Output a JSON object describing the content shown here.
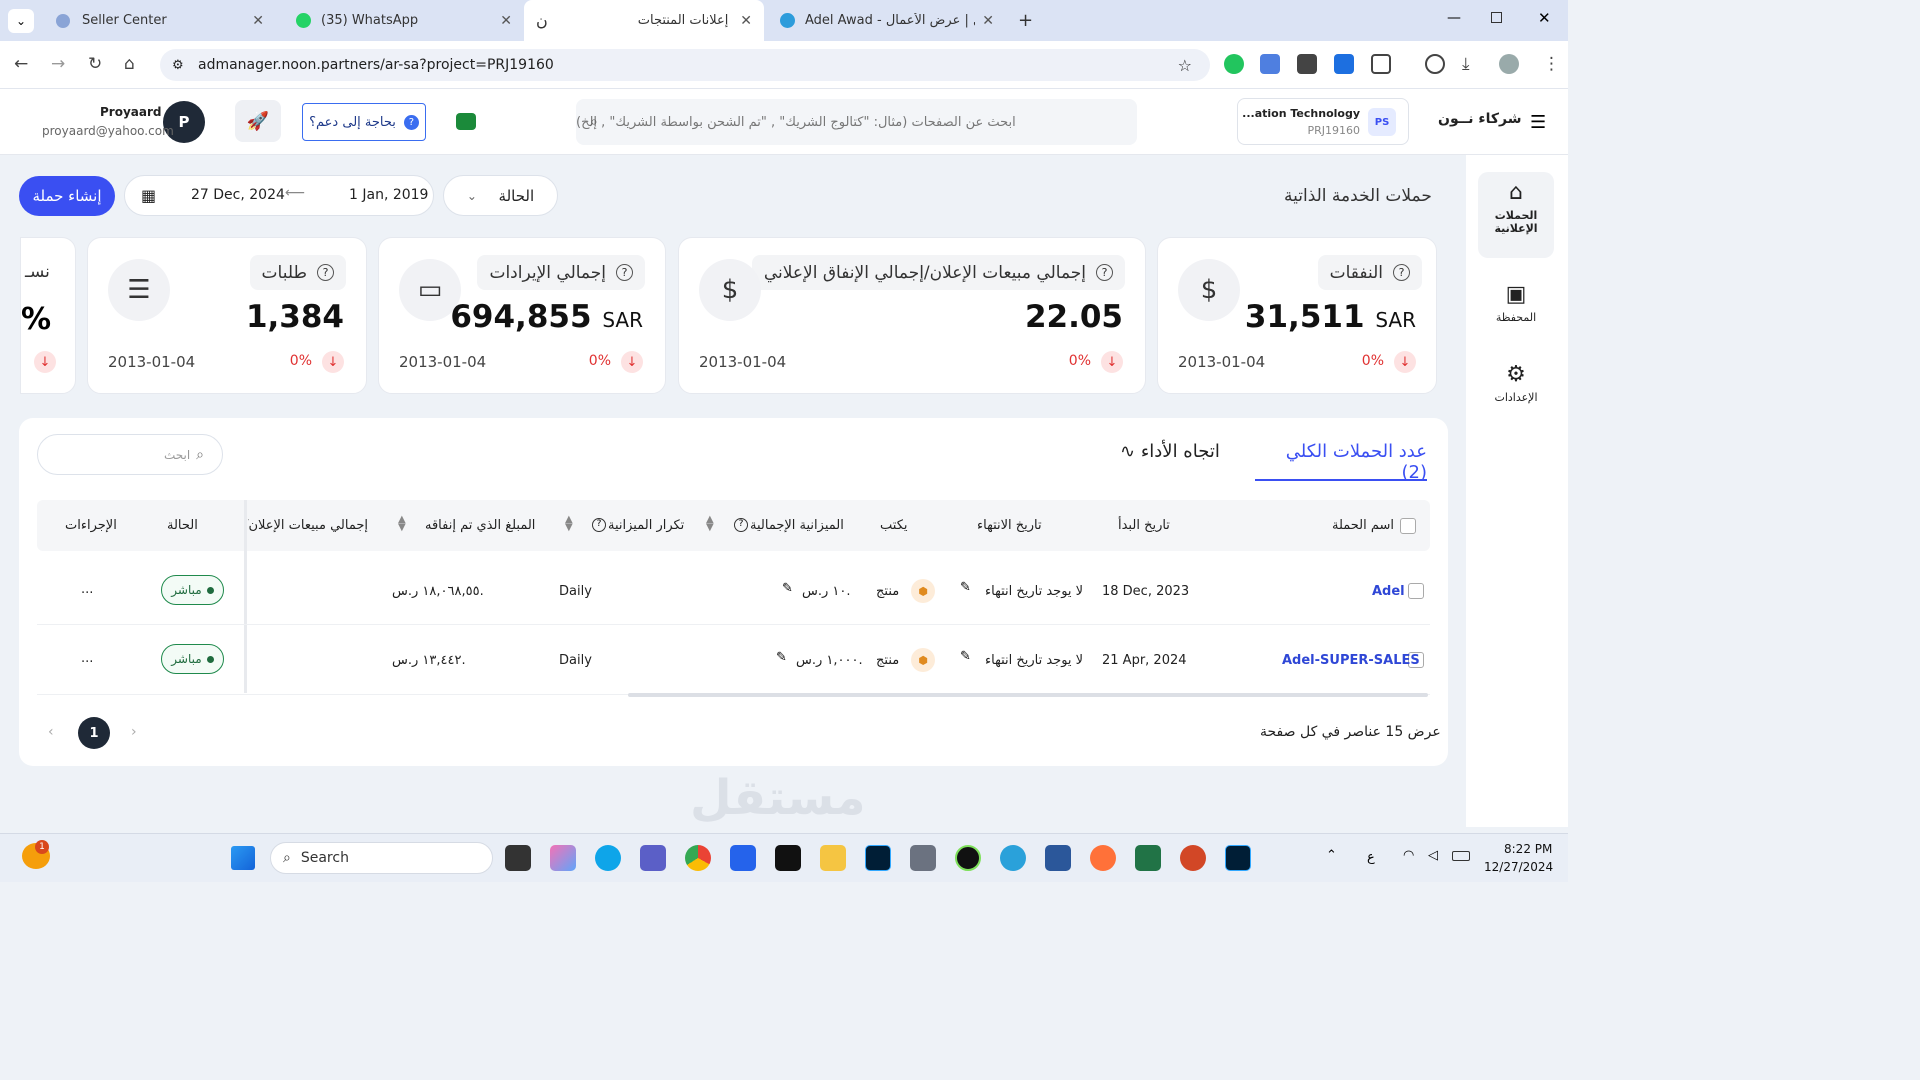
{
  "browser": {
    "tabs": [
      {
        "title": "Seller Center",
        "active": false
      },
      {
        "title": "(35) WhatsApp",
        "active": false
      },
      {
        "title": "إعلانات المنتجات",
        "active": true
      },
      {
        "title": "Adel Awad - مستقل | عرض الأعمال",
        "active": false
      }
    ],
    "url": "admanager.noon.partners/ar-sa?project=PRJ19160"
  },
  "header": {
    "brand": "شركاء نــون",
    "project_name": "...ation Technology",
    "project_id": "PRJ19160",
    "project_badge": "PS",
    "search_placeholder": "ابحث عن الصفحات (مثال: \"كتالوج الشريك\" , \"تم الشحن بواسطة الشريك\" , إلخ)",
    "help_label": "بحاجة إلى دعم؟",
    "user_name": "Proyaard",
    "user_email": "proyaard@yahoo.com",
    "avatar_letter": "P"
  },
  "sidenav": [
    {
      "label": "الحملات الإعلانية",
      "icon": "home-icon",
      "active": true
    },
    {
      "label": "المحفظة",
      "icon": "wallet-icon",
      "active": false
    },
    {
      "label": "الإعدادات",
      "icon": "settings-icon",
      "active": false
    }
  ],
  "toolbar": {
    "title": "حملات الخدمة الذاتية",
    "status_filter": "الحالة",
    "date_from": "1 Jan, 2019",
    "date_to": "27 Dec, 2024",
    "create_label": "إنشاء حملة"
  },
  "kpis": [
    {
      "label": "النفقات",
      "value": "31,511",
      "unit": "SAR",
      "date": "2013-01-04",
      "change": "0%",
      "icon": "dollar-coin-icon"
    },
    {
      "label": "إجمالي مبيعات الإعلان/إجمالي الإنفاق الإعلاني",
      "value": "22.05",
      "unit": "",
      "date": "2013-01-04",
      "change": "0%",
      "icon": "dollar-return-icon"
    },
    {
      "label": "إجمالي الإيرادات",
      "value": "694,855",
      "unit": "SAR",
      "date": "2013-01-04",
      "change": "0%",
      "icon": "banknote-icon"
    },
    {
      "label": "طلبات",
      "value": "1,384",
      "unit": "",
      "date": "2013-01-04",
      "change": "0%",
      "icon": "orders-list-icon"
    },
    {
      "label": "نسـ",
      "value": "%",
      "unit": "",
      "date": "",
      "change": "",
      "icon": ""
    }
  ],
  "panel": {
    "tab_count": "عدد الحملات الكلي (2)",
    "tab_trend": "اتجاه الأداء",
    "search_placeholder": "ابحث",
    "columns": [
      "اسم الحملة",
      "تاريخ البدأ",
      "تاريخ الانتهاء",
      "يكتب",
      "الميزانية الإجمالية",
      "تكرار الميزانية",
      "المبلغ الذي تم إنفاقه",
      "إجمالي مبيعات الإعلان/إ",
      "الحالة",
      "الإجراءات"
    ],
    "rows": [
      {
        "name": "Adel",
        "start": "18 Dec, 2023",
        "end": "لا يوجد تاريخ انتهاء",
        "type": "منتج",
        "budget": "١٠ ر.س.",
        "frequency": "Daily",
        "spent": "١٨,٠٦٨,٥٥ ر.س.",
        "status": "مباشر",
        "actions": "..."
      },
      {
        "name": "Adel-SUPER-SALES",
        "start": "21 Apr, 2024",
        "end": "لا يوجد تاريخ انتهاء",
        "type": "منتج",
        "budget": "١,٠٠٠ ر.س.",
        "frequency": "Daily",
        "spent": "١٣,٤٤٢ ر.س.",
        "status": "مباشر",
        "actions": "..."
      }
    ],
    "page_size_label": "عرض 15 عناصر في كل صفحة",
    "current_page": "1"
  },
  "taskbar": {
    "search_label": "Search",
    "time": "8:22 PM",
    "date": "12/27/2024",
    "notification_count": "1",
    "lang": "ع"
  },
  "watermark": "مستقل",
  "colors": {
    "accent": "#3a4ff2",
    "danger": "#e03131",
    "success": "#1f8a4c"
  }
}
